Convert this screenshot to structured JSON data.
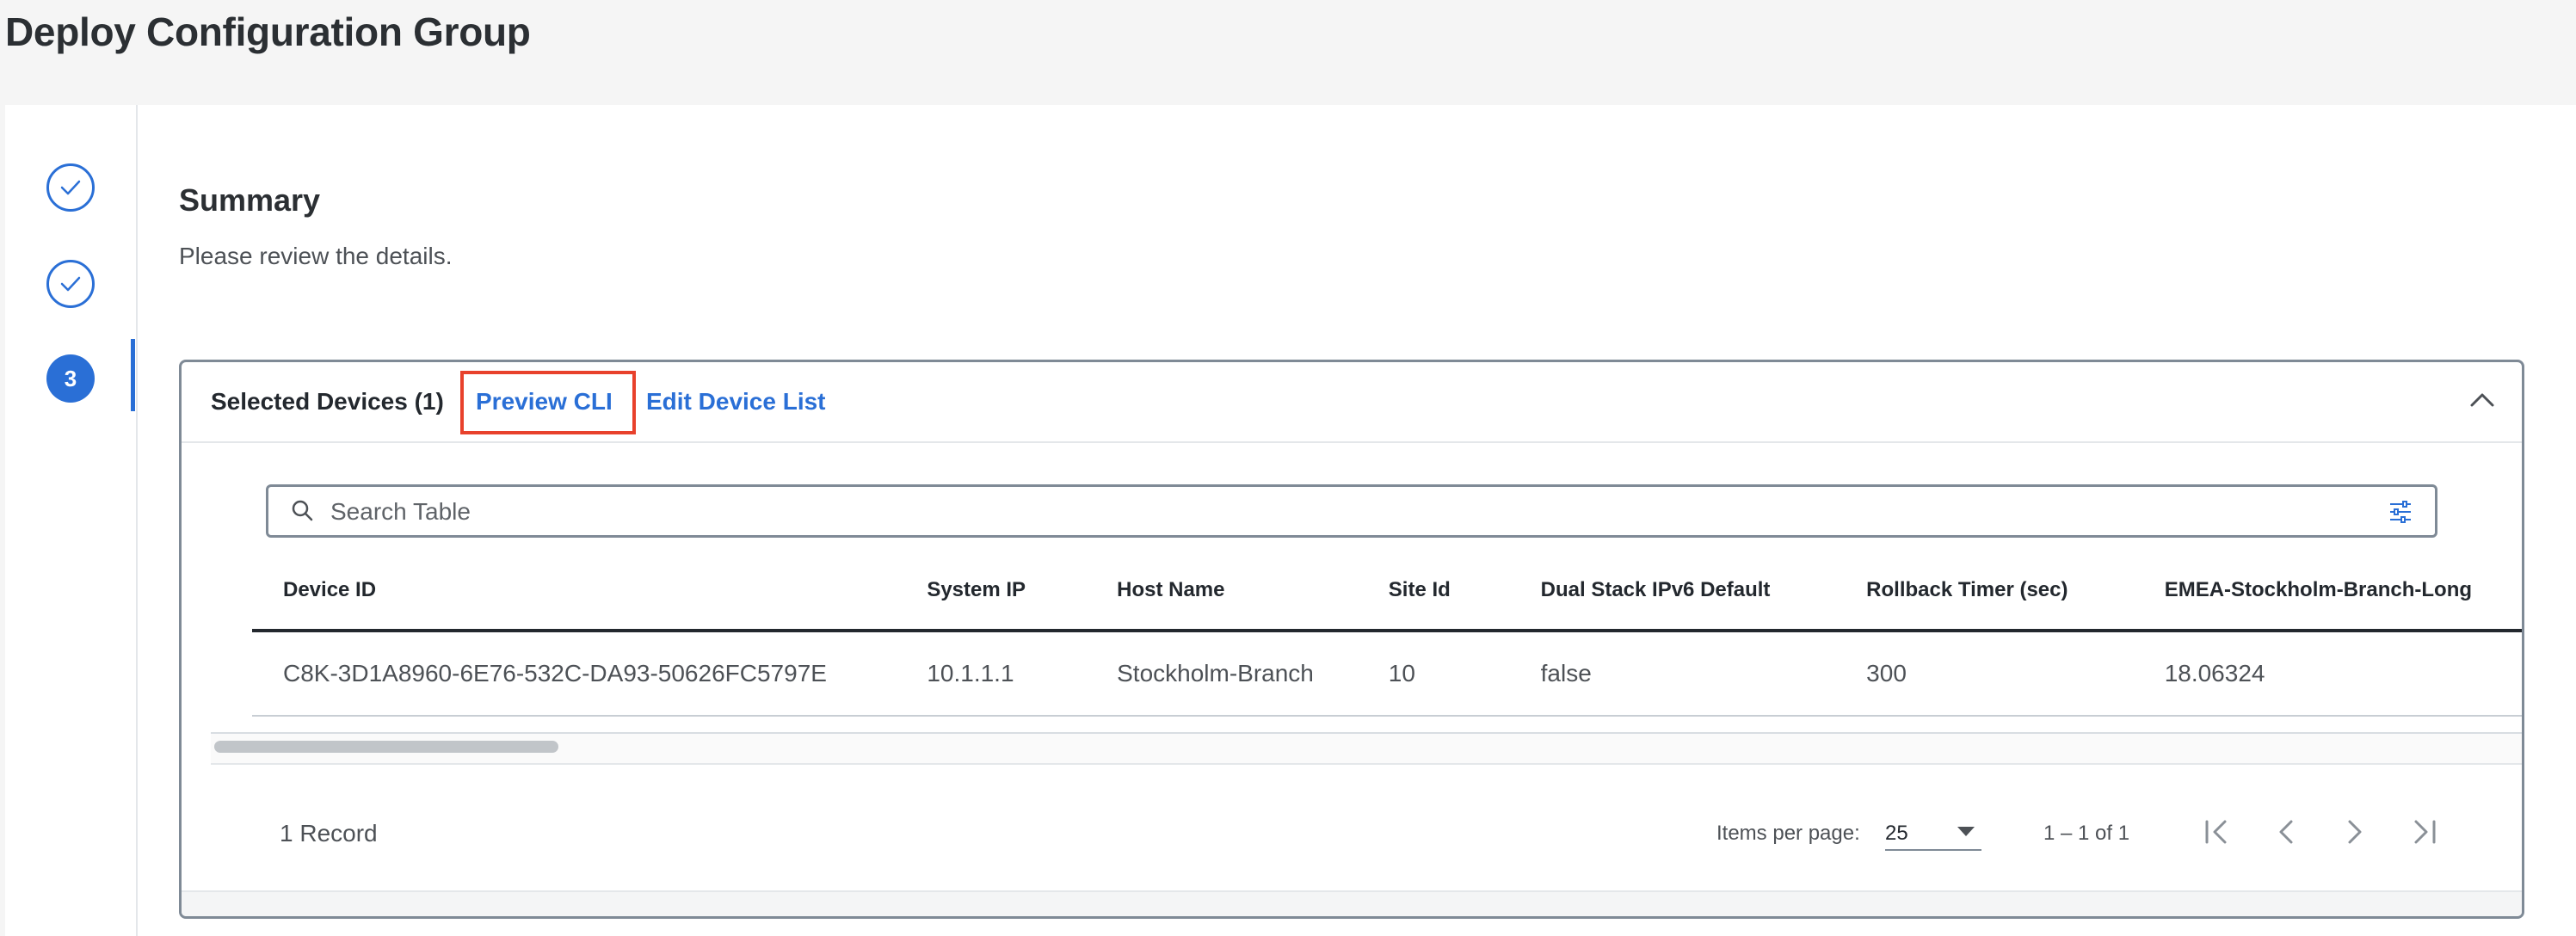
{
  "page": {
    "title": "Deploy Configuration Group"
  },
  "stepper": {
    "current_step": "3"
  },
  "summary": {
    "title": "Summary",
    "subtitle": "Please review the details."
  },
  "panel": {
    "title": "Selected Devices (1)",
    "preview_cli": "Preview CLI",
    "edit_device_list": "Edit Device List"
  },
  "search": {
    "placeholder": "Search Table",
    "value": ""
  },
  "table": {
    "columns": [
      "Device ID",
      "System IP",
      "Host Name",
      "Site Id",
      "Dual Stack IPv6 Default",
      "Rollback Timer (sec)",
      "EMEA-Stockholm-Branch-Long"
    ],
    "rows": [
      [
        "C8K-3D1A8960-6E76-532C-DA93-50626FC5797E",
        "10.1.1.1",
        "Stockholm-Branch",
        "10",
        "false",
        "300",
        "18.06324"
      ]
    ]
  },
  "footer": {
    "record_count": "1 Record",
    "items_per_page_label": "Items per page:",
    "items_per_page_value": "25",
    "range_text": "1 – 1 of 1"
  },
  "colors": {
    "accent": "#2a6fd6",
    "highlight": "#e8412c"
  }
}
